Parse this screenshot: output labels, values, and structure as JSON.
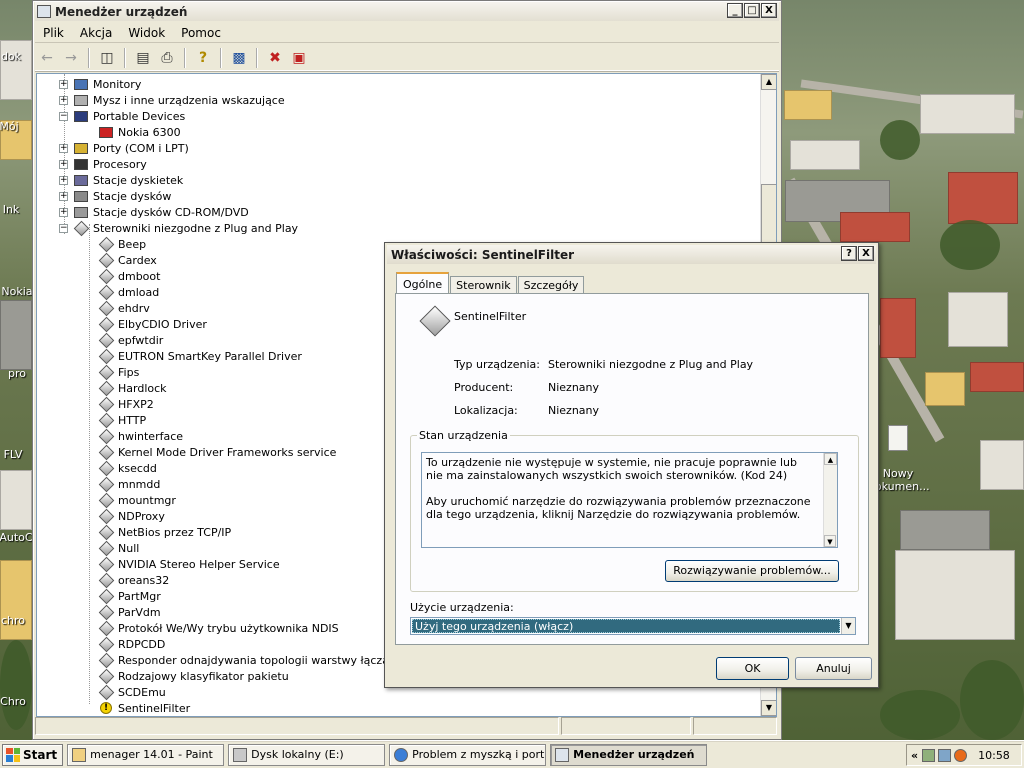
{
  "desktop": {
    "icons": [
      {
        "label": "dok"
      },
      {
        "label": "Mój"
      },
      {
        "label": "Ink"
      },
      {
        "label": "Nokia"
      },
      {
        "label": "pro"
      },
      {
        "label": "FLV"
      },
      {
        "label": "AutoC"
      },
      {
        "label": "chro"
      },
      {
        "label": "Chro"
      },
      {
        "label": "Nowy\nDokumen..."
      }
    ]
  },
  "devmgr": {
    "title": "Menedżer urządzeń",
    "menu": [
      "Plik",
      "Akcja",
      "Widok",
      "Pomoc"
    ],
    "tree": [
      {
        "label": "Monitory",
        "level": 0,
        "expander": "+"
      },
      {
        "label": "Mysz i inne urządzenia wskazujące",
        "level": 0,
        "expander": "+"
      },
      {
        "label": "Portable Devices",
        "level": 0,
        "expander": "-"
      },
      {
        "label": "Nokia 6300",
        "level": 1,
        "expander": ""
      },
      {
        "label": "Porty (COM i LPT)",
        "level": 0,
        "expander": "+"
      },
      {
        "label": "Procesory",
        "level": 0,
        "expander": "+"
      },
      {
        "label": "Stacje dyskietek",
        "level": 0,
        "expander": "+"
      },
      {
        "label": "Stacje dysków",
        "level": 0,
        "expander": "+"
      },
      {
        "label": "Stacje dysków CD-ROM/DVD",
        "level": 0,
        "expander": "+"
      },
      {
        "label": "Sterowniki niezgodne z Plug and Play",
        "level": 0,
        "expander": "-"
      },
      {
        "label": "Beep",
        "level": 1,
        "expander": ""
      },
      {
        "label": "Cardex",
        "level": 1,
        "expander": ""
      },
      {
        "label": "dmboot",
        "level": 1,
        "expander": ""
      },
      {
        "label": "dmload",
        "level": 1,
        "expander": ""
      },
      {
        "label": "ehdrv",
        "level": 1,
        "expander": ""
      },
      {
        "label": "ElbyCDIO Driver",
        "level": 1,
        "expander": ""
      },
      {
        "label": "epfwtdir",
        "level": 1,
        "expander": ""
      },
      {
        "label": "EUTRON SmartKey Parallel Driver",
        "level": 1,
        "expander": ""
      },
      {
        "label": "Fips",
        "level": 1,
        "expander": ""
      },
      {
        "label": "Hardlock",
        "level": 1,
        "expander": ""
      },
      {
        "label": "HFXP2",
        "level": 1,
        "expander": ""
      },
      {
        "label": "HTTP",
        "level": 1,
        "expander": ""
      },
      {
        "label": "hwinterface",
        "level": 1,
        "expander": ""
      },
      {
        "label": "Kernel Mode Driver Frameworks service",
        "level": 1,
        "expander": ""
      },
      {
        "label": "ksecdd",
        "level": 1,
        "expander": ""
      },
      {
        "label": "mnmdd",
        "level": 1,
        "expander": ""
      },
      {
        "label": "mountmgr",
        "level": 1,
        "expander": ""
      },
      {
        "label": "NDProxy",
        "level": 1,
        "expander": ""
      },
      {
        "label": "NetBios przez TCP/IP",
        "level": 1,
        "expander": ""
      },
      {
        "label": "Null",
        "level": 1,
        "expander": ""
      },
      {
        "label": "NVIDIA Stereo Helper Service",
        "level": 1,
        "expander": ""
      },
      {
        "label": "oreans32",
        "level": 1,
        "expander": ""
      },
      {
        "label": "PartMgr",
        "level": 1,
        "expander": ""
      },
      {
        "label": "ParVdm",
        "level": 1,
        "expander": ""
      },
      {
        "label": "Protokół We/Wy trybu użytkownika NDIS",
        "level": 1,
        "expander": ""
      },
      {
        "label": "RDPCDD",
        "level": 1,
        "expander": ""
      },
      {
        "label": "Responder odnajdywania topologii warstwy łącza",
        "level": 1,
        "expander": ""
      },
      {
        "label": "Rodzajowy klasyfikator pakietu",
        "level": 1,
        "expander": ""
      },
      {
        "label": "SCDEmu",
        "level": 1,
        "expander": ""
      },
      {
        "label": "SentinelFilter",
        "level": 1,
        "expander": "",
        "warning": true
      }
    ]
  },
  "props": {
    "title": "Właściwości: SentinelFilter",
    "help_btn": "?",
    "close_btn": "X",
    "tabs": [
      "Ogólne",
      "Sterownik",
      "Szczegóły"
    ],
    "device_name": "SentinelFilter",
    "fields": [
      {
        "label": "Typ urządzenia:",
        "value": "Sterowniki niezgodne z Plug and Play"
      },
      {
        "label": "Producent:",
        "value": "Nieznany"
      },
      {
        "label": "Lokalizacja:",
        "value": "Nieznany"
      }
    ],
    "status_group_label": "Stan urządzenia",
    "status_text_1": "To urządzenie nie występuje w systemie, nie pracuje poprawnie lub nie ma zainstalowanych wszystkich swoich sterowników. (Kod 24)",
    "status_text_2": "Aby uruchomić narzędzie do rozwiązywania problemów przeznaczone dla tego urządzenia, kliknij Narzędzie do rozwiązywania problemów.",
    "troubleshoot_btn": "Rozwiązywanie problemów...",
    "usage_label": "Użycie urządzenia:",
    "usage_value": "Użyj tego urządzenia (włącz)",
    "ok_btn": "OK",
    "cancel_btn": "Anuluj"
  },
  "taskbar": {
    "start": "Start",
    "tasks": [
      {
        "label": "menager 14.01 - Paint",
        "active": false
      },
      {
        "label": "Dysk lokalny (E:)",
        "active": false
      },
      {
        "label": "Problem z myszką i porta...",
        "active": false
      },
      {
        "label": "Menedżer urządzeń",
        "active": true
      }
    ],
    "tray_chevron": "«",
    "clock": "10:58"
  },
  "colors": {
    "titlebar_text": "#222222",
    "select_highlight": "#316a7f",
    "warning": "#f5d300"
  }
}
